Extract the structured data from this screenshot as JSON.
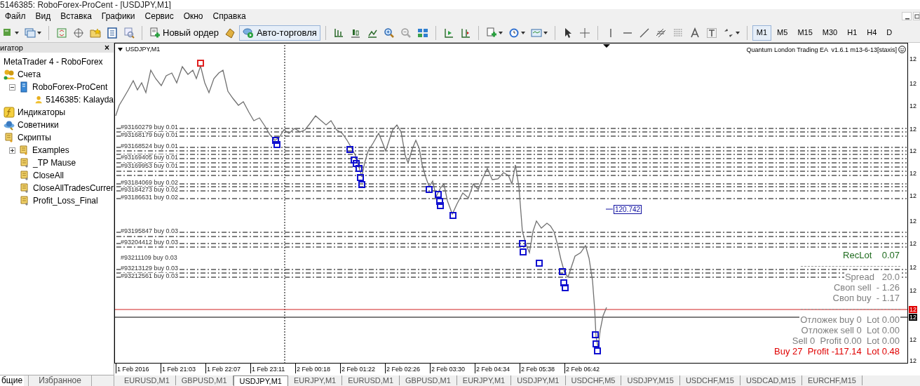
{
  "window": {
    "title": "5146385: RoboForex-ProCent - [USDJPY,M1]"
  },
  "menu": [
    "Файл",
    "Вид",
    "Вставка",
    "Графики",
    "Сервис",
    "Окно",
    "Справка"
  ],
  "toolbar": {
    "new_order": "Новый ордер",
    "auto_trading": {
      "label": "Авто-торговля",
      "selected": true
    },
    "timeframes": [
      {
        "label": "M1",
        "selected": true
      },
      {
        "label": "M5",
        "selected": false
      },
      {
        "label": "M15",
        "selected": false
      },
      {
        "label": "M30",
        "selected": false
      },
      {
        "label": "H1",
        "selected": false
      },
      {
        "label": "H4",
        "selected": false
      },
      {
        "label": "D",
        "selected": false
      }
    ]
  },
  "navigator": {
    "title": "игатор",
    "close": "×",
    "tree": [
      {
        "label": "MetaTrader 4 - RoboForex",
        "kind": "root"
      },
      {
        "label": "Счета",
        "kind": "accounts",
        "children": [
          {
            "label": "RoboForex-ProCent",
            "kind": "server",
            "expanded": true,
            "children": [
              {
                "label": "5146385: Kalayda",
                "kind": "user"
              }
            ]
          }
        ]
      },
      {
        "label": "Индикаторы",
        "kind": "indicators"
      },
      {
        "label": "Советники",
        "kind": "experts"
      },
      {
        "label": "Скрипты",
        "kind": "scripts",
        "children": [
          {
            "label": "Examples",
            "kind": "folder",
            "expanded": false
          },
          {
            "label": "_TP Mause",
            "kind": "script"
          },
          {
            "label": "CloseAll",
            "kind": "script"
          },
          {
            "label": "CloseAllTradesCurrer",
            "kind": "script"
          },
          {
            "label": "Profit_Loss_Final",
            "kind": "script"
          }
        ]
      }
    ],
    "tabs": [
      {
        "label": "бщие",
        "selected": true
      },
      {
        "label": "Избранное",
        "selected": false
      }
    ]
  },
  "chart": {
    "symbol": "USDJPY,M1",
    "expert": "Quantum London Trading EA  v1.6.1 m13-6-13[staxis]",
    "price_label": "120.742",
    "orders": [
      "#93160279 buy 0.01",
      "#93168179 buy 0.01",
      "#93168524 buy 0.01",
      "#93169405 buy 0.01",
      "#93169953 buy 0.01",
      "#93184069 buy 0.02",
      "#93184273 buy 0.02",
      "#93186631 buy 0.02",
      "#93195847 buy 0.03",
      "#93204412 buy 0.03",
      "#93211109 buy 0.03",
      "#93213129 buy 0.03",
      "#93212561 buy 0.03"
    ],
    "info": [
      {
        "text": "RecLot    0.07",
        "color": "#1e6b1e"
      },
      {
        "text": "Spread   20.0",
        "color": "#7f7f7f"
      },
      {
        "text": "Своп sell  - 1.26",
        "color": "#7f7f7f"
      },
      {
        "text": "Своп buy  - 1.17",
        "color": "#7f7f7f"
      },
      {
        "text": "Отложек buy 0  Lot 0.00",
        "color": "#7f7f7f"
      },
      {
        "text": "Отложек sell 0  Lot 0.00",
        "color": "#7f7f7f"
      },
      {
        "text": "Sell 0  Profit 0.00  Lot 0.00",
        "color": "#7f7f7f"
      },
      {
        "text": "Buy 27  Profit -117.14  Lot 0.48",
        "color": "#e00000"
      }
    ],
    "price_axis": [
      {
        "text": "12",
        "kind": "tick"
      },
      {
        "text": "12",
        "kind": "tick"
      },
      {
        "text": "12",
        "kind": "tick"
      },
      {
        "text": "12",
        "kind": "tick"
      },
      {
        "text": "12",
        "kind": "tick"
      },
      {
        "text": "12",
        "kind": "tick"
      },
      {
        "text": "12",
        "kind": "tick"
      },
      {
        "text": "12",
        "kind": "tick"
      },
      {
        "text": "12",
        "kind": "tick"
      },
      {
        "text": "12",
        "kind": "tick"
      },
      {
        "text": "12",
        "kind": "tick"
      },
      {
        "text": "12",
        "kind": "ask"
      },
      {
        "text": "12",
        "kind": "bid"
      },
      {
        "text": "12",
        "kind": "tick"
      },
      {
        "text": "12",
        "kind": "tick"
      }
    ],
    "time_axis": [
      "1 Feb 2016",
      "1 Feb 21:03",
      "1 Feb 22:07",
      "1 Feb 23:11",
      "2 Feb 00:18",
      "2 Feb 01:22",
      "2 Feb 02:26",
      "2 Feb 03:30",
      "2 Feb 04:34",
      "2 Feb 05:38",
      "2 Feb 06:42"
    ]
  },
  "chart_tabs": [
    {
      "label": "EURUSD,M1",
      "selected": false
    },
    {
      "label": "GBPUSD,M1",
      "selected": false
    },
    {
      "label": "USDJPY,M1",
      "selected": true
    },
    {
      "label": "EURJPY,M1",
      "selected": false
    },
    {
      "label": "EURUSD,M1",
      "selected": false
    },
    {
      "label": "GBPUSD,M1",
      "selected": false
    },
    {
      "label": "EURJPY,M1",
      "selected": false
    },
    {
      "label": "USDJPY,M1",
      "selected": false
    },
    {
      "label": "USDCHF,M5",
      "selected": false
    },
    {
      "label": "USDJPY,M15",
      "selected": false
    },
    {
      "label": "USDCHF,M15",
      "selected": false
    },
    {
      "label": "USDCAD,M15",
      "selected": false
    },
    {
      "label": "EURCHF,M15",
      "selected": false
    }
  ]
}
